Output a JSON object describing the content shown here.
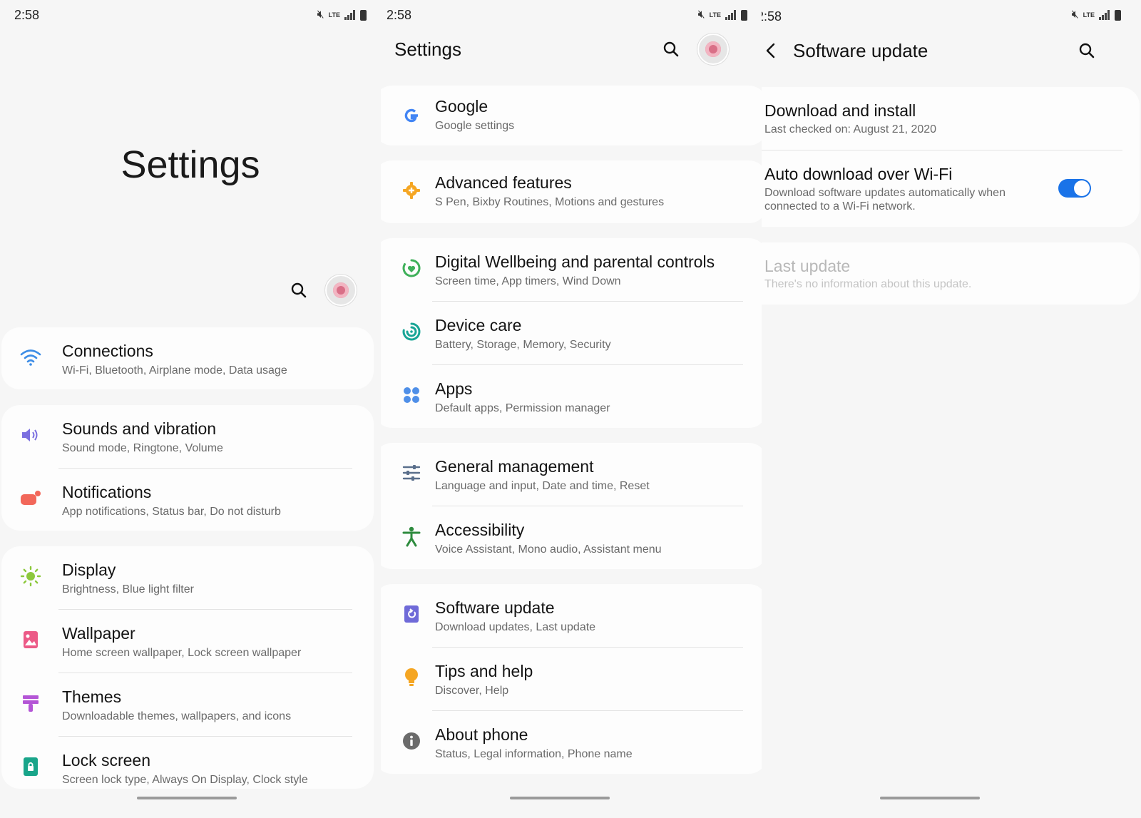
{
  "status": {
    "time": "2:58",
    "network": "LTE"
  },
  "screen1": {
    "title": "Settings",
    "items": [
      {
        "title": "Connections",
        "subtitle": "Wi-Fi, Bluetooth, Airplane mode, Data usage",
        "icon": "wifi-icon",
        "color": "#3d8de6"
      },
      {
        "title": "Sounds and vibration",
        "subtitle": "Sound mode, Ringtone, Volume",
        "icon": "speaker-icon",
        "color": "#7b6fe0"
      },
      {
        "title": "Notifications",
        "subtitle": "App notifications, Status bar, Do not disturb",
        "icon": "notification-icon",
        "color": "#f2675a"
      },
      {
        "title": "Display",
        "subtitle": "Brightness, Blue light filter",
        "icon": "sun-icon",
        "color": "#8cc83c"
      },
      {
        "title": "Wallpaper",
        "subtitle": "Home screen wallpaper, Lock screen wallpaper",
        "icon": "wallpaper-icon",
        "color": "#ec5a87"
      },
      {
        "title": "Themes",
        "subtitle": "Downloadable themes, wallpapers, and icons",
        "icon": "brush-icon",
        "color": "#b455d6"
      },
      {
        "title": "Lock screen",
        "subtitle": "Screen lock type, Always On Display, Clock style",
        "icon": "lock-icon",
        "color": "#19a58a"
      }
    ]
  },
  "screen2": {
    "title": "Settings",
    "items": [
      {
        "title": "Google",
        "subtitle": "Google settings",
        "icon": "google-icon",
        "color": "#4285f4"
      },
      {
        "title": "Advanced features",
        "subtitle": "S Pen, Bixby Routines, Motions and gestures",
        "icon": "gear-plus-icon",
        "color": "#f5a623"
      },
      {
        "title": "Digital Wellbeing and parental controls",
        "subtitle": "Screen time, App timers, Wind Down",
        "icon": "wellbeing-icon",
        "color": "#3fb05a"
      },
      {
        "title": "Device care",
        "subtitle": "Battery, Storage, Memory, Security",
        "icon": "device-care-icon",
        "color": "#18a596"
      },
      {
        "title": "Apps",
        "subtitle": "Default apps, Permission manager",
        "icon": "apps-icon",
        "color": "#4f8fe8"
      },
      {
        "title": "General management",
        "subtitle": "Language and input, Date and time, Reset",
        "icon": "sliders-icon",
        "color": "#5a6f8c"
      },
      {
        "title": "Accessibility",
        "subtitle": "Voice Assistant, Mono audio, Assistant menu",
        "icon": "accessibility-icon",
        "color": "#2e8b3e"
      },
      {
        "title": "Software update",
        "subtitle": "Download updates, Last update",
        "icon": "software-update-icon",
        "color": "#6f6ad8"
      },
      {
        "title": "Tips and help",
        "subtitle": "Discover, Help",
        "icon": "lightbulb-icon",
        "color": "#f5a623"
      },
      {
        "title": "About phone",
        "subtitle": "Status, Legal information, Phone name",
        "icon": "info-icon",
        "color": "#6b6b6b"
      }
    ]
  },
  "screen3": {
    "title": "Software update",
    "download": {
      "title": "Download and install",
      "subtitle": "Last checked on: August 21, 2020"
    },
    "auto": {
      "title": "Auto download over Wi-Fi",
      "subtitle_line1": "Download software updates automatically when",
      "subtitle_line2": "connected to a Wi-Fi network.",
      "enabled": true
    },
    "last": {
      "title": "Last update",
      "subtitle": "There's no information about this update."
    }
  }
}
